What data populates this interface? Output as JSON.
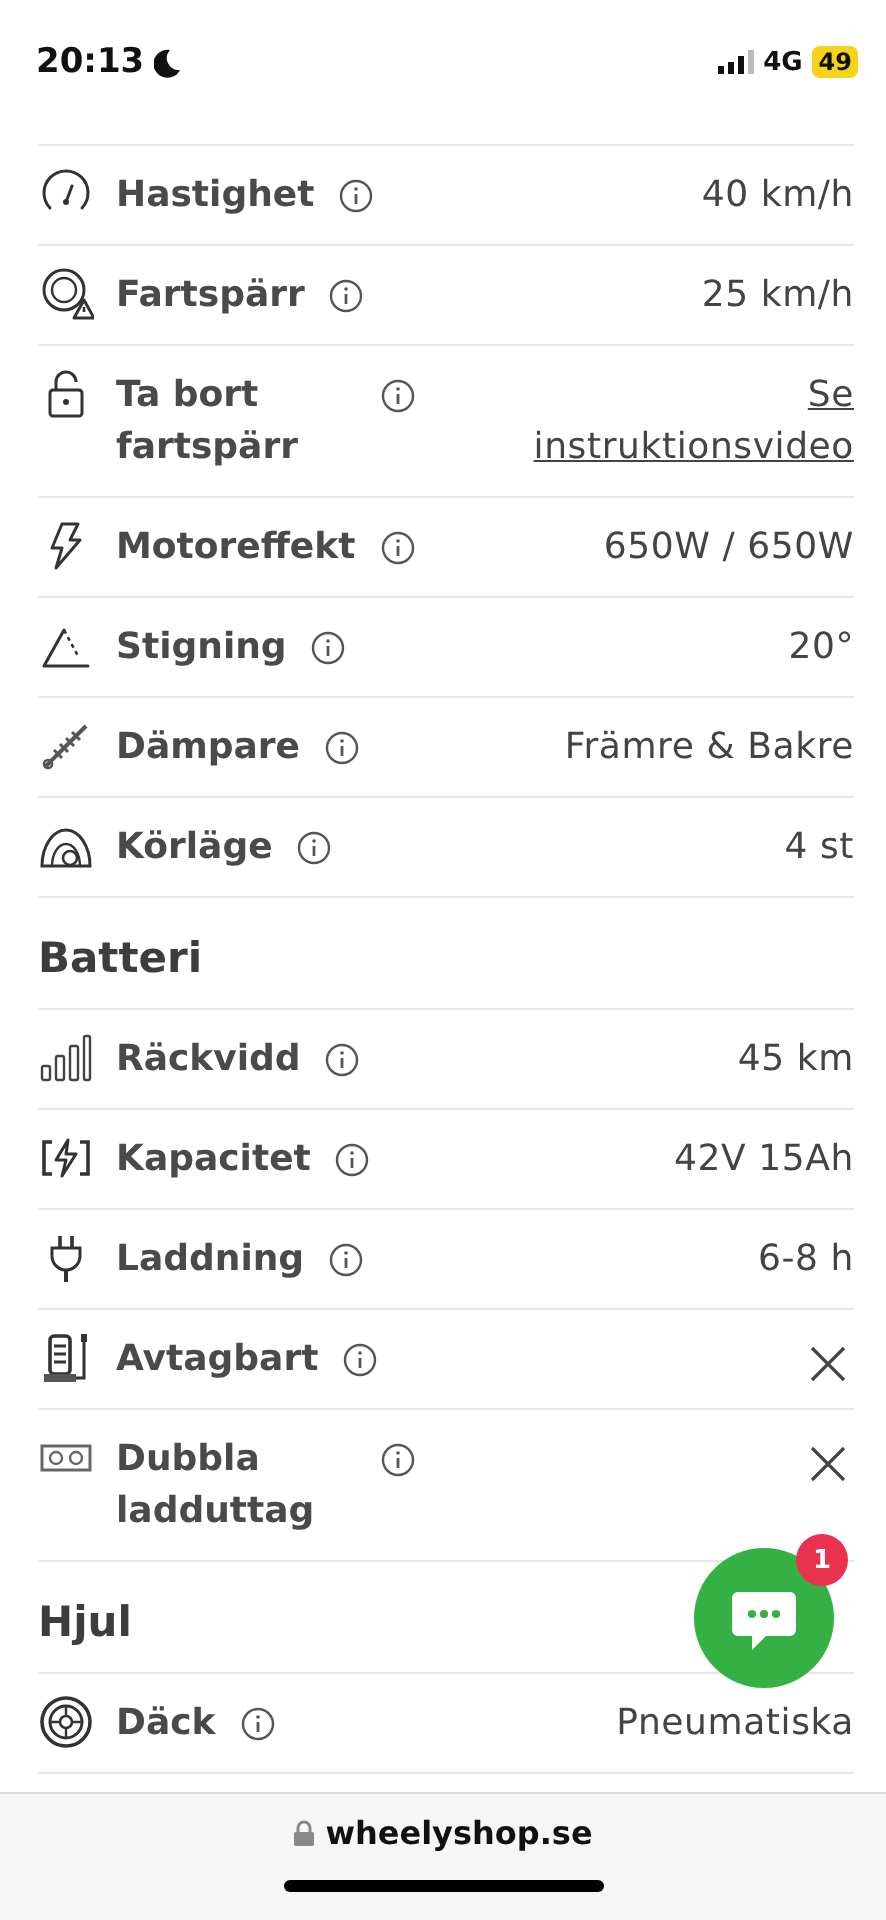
{
  "status_bar": {
    "time": "20:13",
    "network": "4G",
    "battery": "49"
  },
  "sections": [
    {
      "rows": [
        {
          "label": "Hastighet",
          "kind": "text",
          "value": "40 km/h"
        },
        {
          "label": "Fartspärr",
          "kind": "text",
          "value": "25 km/h"
        },
        {
          "label": "Ta bort fartspärr",
          "kind": "link",
          "value": "Se instruktionsvideo"
        },
        {
          "label": "Motoreffekt",
          "kind": "text",
          "value": "650W / 650W"
        },
        {
          "label": "Stigning",
          "kind": "text",
          "value": "20°"
        },
        {
          "label": "Dämpare",
          "kind": "text",
          "value": "Främre & Bakre"
        },
        {
          "label": "Körläge",
          "kind": "text",
          "value": "4 st"
        }
      ]
    },
    {
      "title": "Batteri",
      "rows": [
        {
          "label": "Räckvidd",
          "kind": "text",
          "value": "45 km"
        },
        {
          "label": "Kapacitet",
          "kind": "text",
          "value": "42V 15Ah"
        },
        {
          "label": "Laddning",
          "kind": "text",
          "value": "6-8 h"
        },
        {
          "label": "Avtagbart",
          "kind": "cross"
        },
        {
          "label": "Dubbla ladduttag",
          "kind": "cross"
        }
      ]
    },
    {
      "title": "Hjul",
      "rows": [
        {
          "label": "Däck",
          "kind": "text",
          "value": "Pneumatiska"
        }
      ]
    }
  ],
  "chat": {
    "badge": "1"
  },
  "address_bar": {
    "url": "wheelyshop.se"
  }
}
